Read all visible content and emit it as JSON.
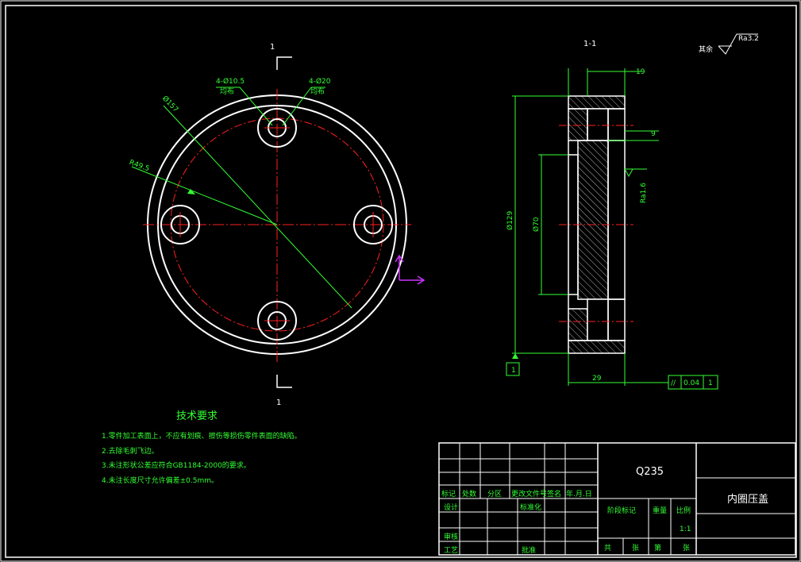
{
  "colors": {
    "background": "#000000",
    "outline": "#ffffff",
    "centerline": "#ff2020",
    "dimension": "#33ff33",
    "ucs_icon": "#cc33ff"
  },
  "front_view": {
    "section_marks": [
      "1",
      "1"
    ],
    "labels": {
      "holes_small": "4-Ø10.5",
      "holes_small_note": "均布",
      "holes_big": "4-Ø20",
      "holes_big_note": "均布",
      "outer_dia": "Ø157",
      "pcd": "R49.5"
    }
  },
  "section_view": {
    "title": "1-1",
    "dims": {
      "top_width": "19",
      "step": "9",
      "height": "Ø129",
      "inner": "Ø70",
      "total_width": "29",
      "roughness_side": "Ra1.6"
    },
    "datum": "1",
    "tolerance": {
      "symbol": "//",
      "value": "0.04",
      "datum": "1"
    }
  },
  "general_roughness": {
    "prefix": "其余",
    "value": "Ra3.2"
  },
  "tech_requirements": {
    "title": "技术要求",
    "items": [
      "1.零件加工表面上，不应有划痕、擦伤等损伤零件表面的缺陷。",
      "2.去除毛刺飞边。",
      "3.未注形状公差应符合GB1184-2000的要求。",
      "4.未注长度尺寸允许偏差±0.5mm。"
    ]
  },
  "title_block": {
    "material": "Q235",
    "part_name": "内圈压盖",
    "row_labels": [
      "标记",
      "处数",
      "分区",
      "更改文件号",
      "签名",
      "年.月.日"
    ],
    "design": "设计",
    "standardization": "标准化",
    "review": "审核",
    "process": "工艺",
    "approve": "批准",
    "stage_mark": "阶段标记",
    "weight": "重量",
    "scale_label": "比例",
    "scale": "1:1",
    "total": "共",
    "sheets": "张",
    "no": "第",
    "sheets2": "张"
  }
}
